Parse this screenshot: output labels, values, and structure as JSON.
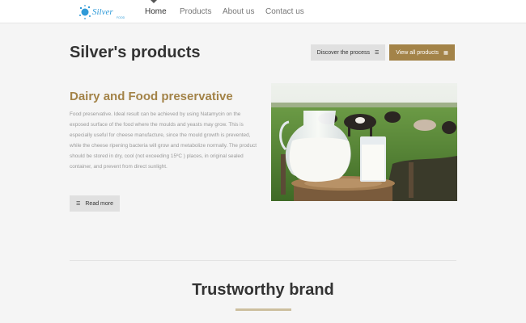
{
  "brand": {
    "logo_text": "Silver",
    "logo_subtext": "FOOD"
  },
  "nav": {
    "items": [
      {
        "label": "Home"
      },
      {
        "label": "Products"
      },
      {
        "label": "About us"
      },
      {
        "label": "Contact us"
      }
    ]
  },
  "header": {
    "title": "Silver's products",
    "discover_label": "Discover the process",
    "view_all_label": "View all products"
  },
  "section": {
    "title": "Dairy and Food preservative",
    "body": "Food preservative. Ideal result can be achieved by using Natamycin on the exposed surface of the food where the moulds and yeasts may grow. This is especially useful for cheese manufacture, since the mould growth is prevented, while the cheese ripening bacteria will grow and metabolize normally. The product should be stored in dry, cool (not exceeding 15ºC ) places, in original sealed container, and prevent from direct sunlight.",
    "read_more_label": "Read more"
  },
  "trust": {
    "title": "Trustworthy brand"
  },
  "colors": {
    "accent": "#a38348",
    "text_dark": "#333333",
    "muted": "#999999",
    "background": "#f5f5f5"
  }
}
